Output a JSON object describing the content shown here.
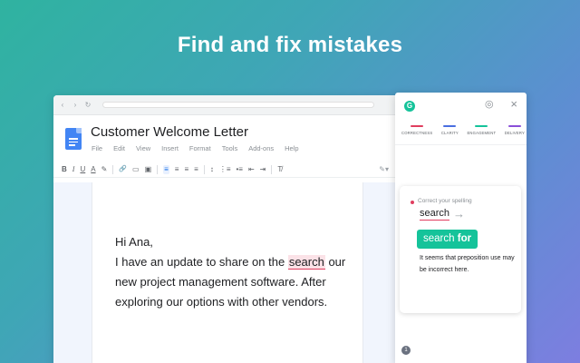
{
  "headline": "Find and fix mistakes",
  "browser": {
    "nav_icons": {
      "back": "‹",
      "forward": "›",
      "reload": "↻"
    }
  },
  "docs": {
    "title": "Customer Welcome Letter",
    "menu": [
      "File",
      "Edit",
      "View",
      "Insert",
      "Format",
      "Tools",
      "Add-ons",
      "Help"
    ],
    "toolbar": {
      "bold": "B",
      "italic": "I",
      "underline": "U",
      "text_color": "A",
      "highlight": "✎",
      "link": "🔗",
      "comment": "▭",
      "image": "▣",
      "align_left": "≡",
      "align_center": "≡",
      "align_right": "≡",
      "justify": "≡",
      "line_spacing": "↕",
      "numbered_list": "⋮≡",
      "bulleted_list": "•≡",
      "outdent": "⇤",
      "indent": "⇥",
      "clear_format": "T̸",
      "edit_mode": "✎▾"
    },
    "content": {
      "greeting": "Hi Ana,",
      "line1_before": "I have an update to share on the ",
      "mistake_word": "search",
      "line1_after": " our",
      "line2": "new project management software. After",
      "line3": "exploring our options with other vendors."
    }
  },
  "grammarly": {
    "logo_letter": "G",
    "categories": [
      {
        "label": "CORRECTNESS",
        "color": "#e03e5f"
      },
      {
        "label": "CLARITY",
        "color": "#4a6ee0"
      },
      {
        "label": "ENGAGEMENT",
        "color": "#15c39a"
      },
      {
        "label": "DELIVERY",
        "color": "#8a4fd8"
      }
    ],
    "card": {
      "hint": "Correct your spelling",
      "wrong_word": "search",
      "arrow": "→",
      "accept_word": "search",
      "accept_bold": "for",
      "explanation": "It seems that preposition use may be incorrect here."
    },
    "issue_count": "1",
    "close_glyph": "×",
    "goals_glyph": "◎"
  },
  "colors": {
    "accent_green": "#15c39a",
    "error_red": "#e03e5f",
    "docs_blue": "#4285f4"
  }
}
